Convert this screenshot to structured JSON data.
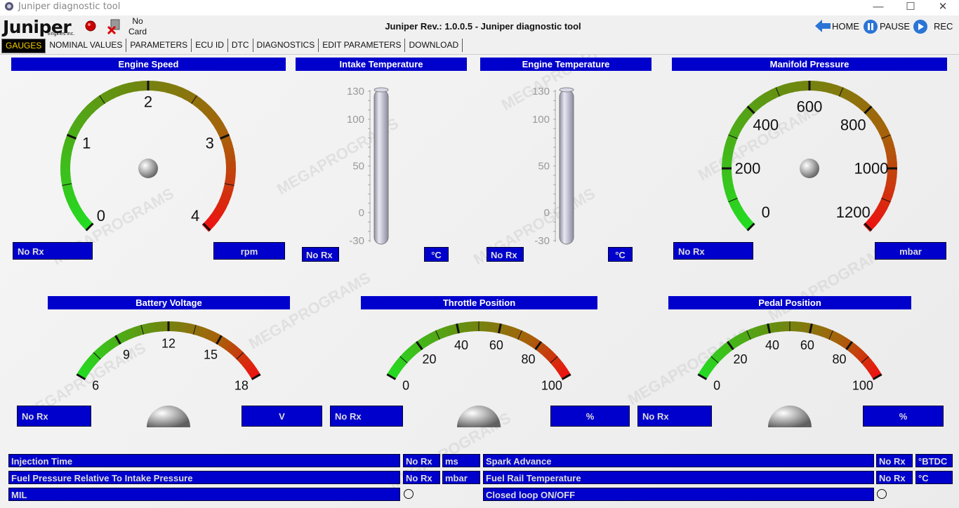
{
  "window": {
    "title": "Juniper diagnostic tool",
    "minimize": "—",
    "maximize": "☐",
    "close": "✕"
  },
  "header": {
    "logo": "Juniper",
    "logo_sub": "Engines inc.",
    "card_status_line1": "No",
    "card_status_line2": "Card",
    "app_title": "Juniper Rev.: 1.0.0.5 - Juniper diagnostic tool",
    "home_label": "HOME",
    "pause_label": "PAUSE",
    "rec_label": "REC"
  },
  "tabs": [
    "GAUGES",
    "NOMINAL VALUES",
    "PARAMETERS",
    "ECU ID",
    "DTC",
    "DIAGNOSTICS",
    "EDIT PARAMETERS",
    "DOWNLOAD"
  ],
  "gauges": {
    "engine_speed": {
      "title": "Engine Speed",
      "value": "No Rx",
      "unit": "rpm",
      "ticks": [
        "0",
        "1",
        "2",
        "3",
        "4"
      ]
    },
    "intake_temp": {
      "title": "Intake Temperature",
      "value": "No Rx",
      "unit": "°C",
      "ticks": [
        "130",
        "100",
        "50",
        "0",
        "-30"
      ]
    },
    "engine_temp": {
      "title": "Engine Temperature",
      "value": "No Rx",
      "unit": "°C",
      "ticks": [
        "130",
        "100",
        "50",
        "0",
        "-30"
      ]
    },
    "manifold_pressure": {
      "title": "Manifold Pressure",
      "value": "No Rx",
      "unit": "mbar",
      "ticks": [
        "0",
        "200",
        "400",
        "600",
        "800",
        "1000",
        "1200"
      ]
    },
    "battery_voltage": {
      "title": "Battery Voltage",
      "value": "No Rx",
      "unit": "V",
      "ticks": [
        "6",
        "9",
        "12",
        "15",
        "18"
      ]
    },
    "throttle_position": {
      "title": "Throttle Position",
      "value": "No Rx",
      "unit": "%",
      "ticks": [
        "0",
        "20",
        "40",
        "60",
        "80",
        "100"
      ]
    },
    "pedal_position": {
      "title": "Pedal Position",
      "value": "No Rx",
      "unit": "%",
      "ticks": [
        "0",
        "20",
        "40",
        "60",
        "80",
        "100"
      ]
    }
  },
  "params": {
    "injection_time": {
      "label": "Injection Time",
      "value": "No Rx",
      "unit": "ms"
    },
    "fuel_pressure": {
      "label": "Fuel Pressure Relative To Intake Pressure",
      "value": "No Rx",
      "unit": "mbar"
    },
    "mil": {
      "label": "MIL"
    },
    "spark_advance": {
      "label": "Spark Advance",
      "value": "No Rx",
      "unit": "°BTDC"
    },
    "fuel_rail_temp": {
      "label": "Fuel Rail Temperature",
      "value": "No Rx",
      "unit": "°C"
    },
    "closed_loop": {
      "label": "Closed loop ON/OFF"
    }
  },
  "watermark": "MEGAPROGRAMS",
  "colors": {
    "panel_blue": "#0000cc",
    "tab_active_bg": "#000000",
    "tab_active_fg": "#ffd200"
  }
}
